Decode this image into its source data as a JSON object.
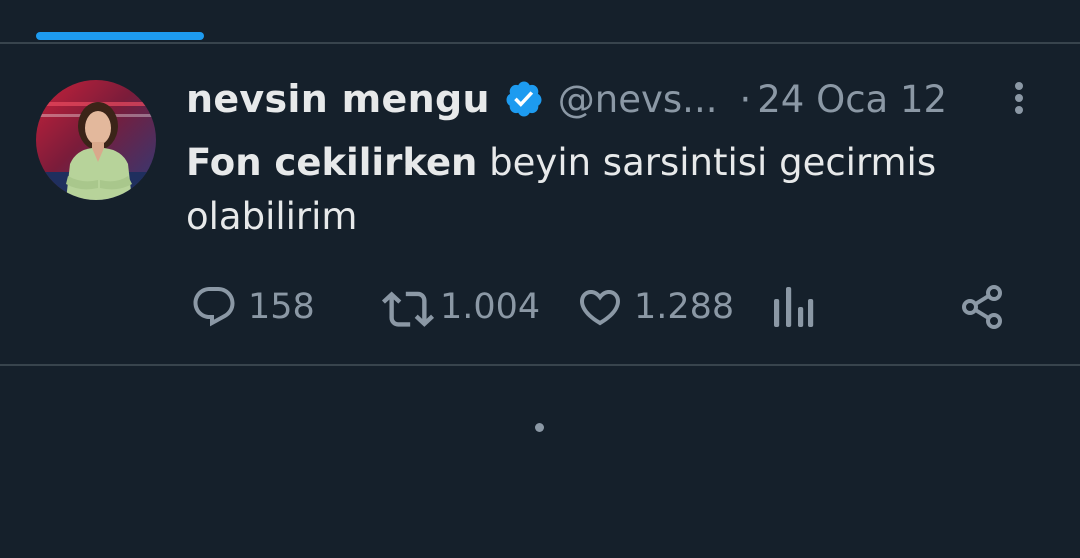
{
  "tweet": {
    "display_name": "nevsin mengu",
    "handle": "@nevs...",
    "separator": "·",
    "date": "24 Oca 12",
    "text_bold": "Fon cekilirken",
    "text_rest": " beyin sarsintisi gecirmis olabilirim"
  },
  "actions": {
    "replies": "158",
    "retweets": "1.004",
    "likes": "1.288"
  },
  "icons": {
    "verified": "verified-badge-icon",
    "more": "more-vertical-icon",
    "reply": "reply-icon",
    "retweet": "retweet-icon",
    "like": "heart-icon",
    "views": "analytics-icon",
    "share": "share-icon"
  },
  "colors": {
    "background": "#15202b",
    "accent": "#1d9bf0",
    "text_primary": "#e7e9ea",
    "text_secondary": "#8b98a5",
    "divider": "#38444d"
  }
}
